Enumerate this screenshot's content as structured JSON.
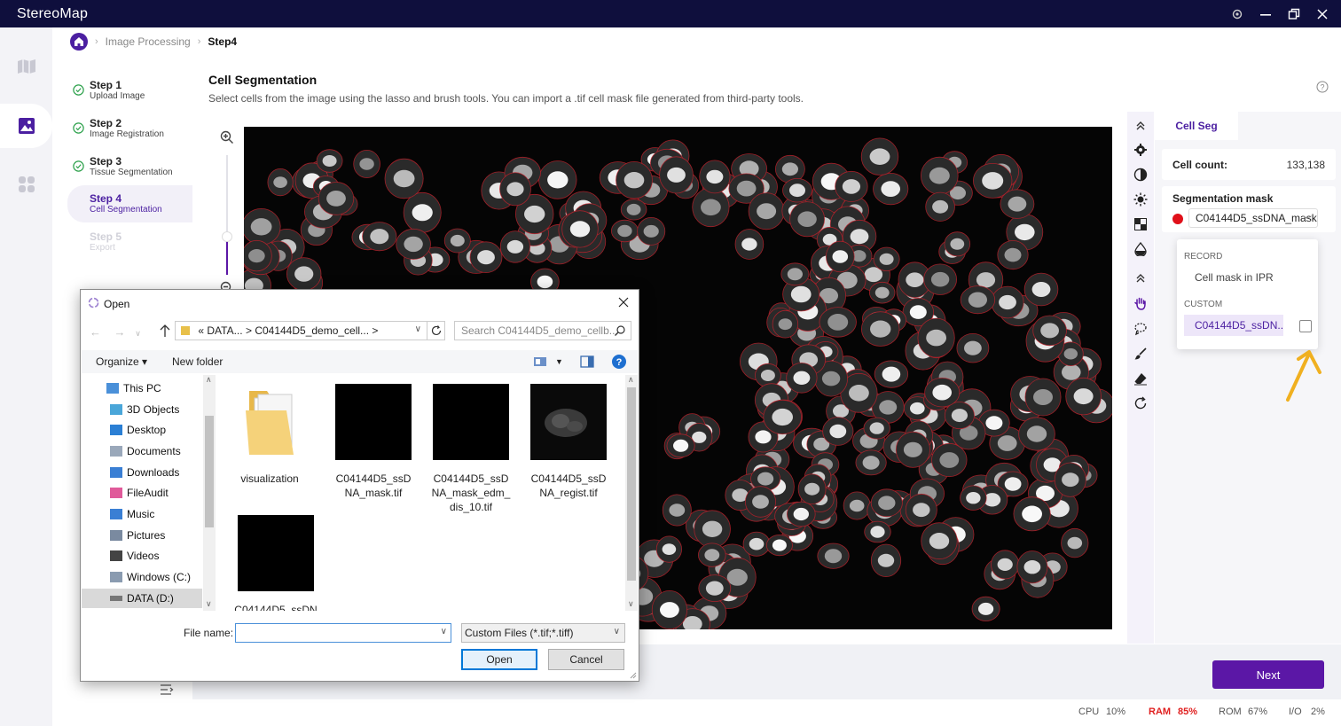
{
  "app": {
    "title": "StereoMap"
  },
  "breadcrumb": {
    "items": [
      "Image Processing",
      "Step4"
    ]
  },
  "steps": [
    {
      "title": "Step 1",
      "subtitle": "Upload Image",
      "state": "done"
    },
    {
      "title": "Step 2",
      "subtitle": "Image Registration",
      "state": "done"
    },
    {
      "title": "Step 3",
      "subtitle": "Tissue Segmentation",
      "state": "done"
    },
    {
      "title": "Step 4",
      "subtitle": "Cell Segmentation",
      "state": "active"
    },
    {
      "title": "Step 5",
      "subtitle": "Export",
      "state": "disabled"
    }
  ],
  "page": {
    "title": "Cell Segmentation",
    "description": "Select cells from the image using the lasso and brush tools. You can import a .tif cell mask file generated from third-party tools."
  },
  "side_panel": {
    "tab": "Cell Seg",
    "cell_count_label": "Cell count:",
    "cell_count_value": "133,138",
    "seg_mask_label": "Segmentation mask",
    "seg_mask_selected": "C04144D5_ssDNA_mask",
    "dropdown": {
      "record_label": "RECORD",
      "record_item": "Cell mask in IPR",
      "custom_label": "CUSTOM",
      "custom_item": "C04144D5_ssDN..."
    }
  },
  "next_button": "Next",
  "status": {
    "cpu_label": "CPU",
    "cpu_value": "10%",
    "ram_label": "RAM",
    "ram_value": "85%",
    "rom_label": "ROM",
    "rom_value": "67%",
    "io_label": "I/O",
    "io_value": "2%"
  },
  "dialog": {
    "title": "Open",
    "address_parts": [
      "«",
      "DATA...",
      ">",
      "C04144D5_demo_cell...",
      ">"
    ],
    "search_placeholder": "Search C04144D5_demo_cellb...",
    "organize": "Organize",
    "new_folder": "New folder",
    "tree": [
      "This PC",
      "3D Objects",
      "Desktop",
      "Documents",
      "Downloads",
      "FileAudit",
      "Music",
      "Pictures",
      "Videos",
      "Windows (C:)",
      "DATA (D:)"
    ],
    "files": [
      {
        "name": "visualization",
        "kind": "folder"
      },
      {
        "name": "C04144D5_ssDNA_mask.tif",
        "kind": "black"
      },
      {
        "name": "C04144D5_ssDNA_mask_edm_dis_10.tif",
        "kind": "black"
      },
      {
        "name": "C04144D5_ssDNA_regist.tif",
        "kind": "tissue"
      },
      {
        "name": "C04144D5_ssDN",
        "kind": "black"
      }
    ],
    "file_name_label": "File name:",
    "file_name_value": "",
    "file_type": "Custom Files (*.tif;*.tiff)",
    "open_button": "Open",
    "cancel_button": "Cancel"
  },
  "colors": {
    "brand": "#5b17a6",
    "titlebar": "#0f0f3d",
    "mask_outline": "#c0202a",
    "arrow": "#f0b020"
  }
}
